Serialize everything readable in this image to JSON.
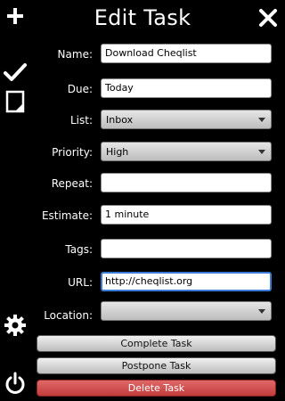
{
  "header": {
    "title": "Edit Task"
  },
  "form": {
    "name": {
      "label": "Name:",
      "value": "Download Cheqlist"
    },
    "due": {
      "label": "Due:",
      "value": "Today"
    },
    "list": {
      "label": "List:",
      "value": "Inbox"
    },
    "priority": {
      "label": "Priority:",
      "value": "High"
    },
    "repeat": {
      "label": "Repeat:",
      "value": ""
    },
    "estimate": {
      "label": "Estimate:",
      "value": "1 minute"
    },
    "tags": {
      "label": "Tags:",
      "value": ""
    },
    "url": {
      "label": "URL:",
      "value": "http://cheqlist.org"
    },
    "location": {
      "label": "Location:",
      "value": ""
    }
  },
  "actions": {
    "complete": "Complete Task",
    "postpone": "Postpone Task",
    "delete": "Delete Task"
  },
  "sidebar": {
    "icons": [
      "plus-icon",
      "checkmark-icon",
      "note-icon",
      "gear-icon",
      "power-icon"
    ]
  },
  "colors": {
    "delete": "#c94343",
    "focus": "#3a7bd5"
  }
}
